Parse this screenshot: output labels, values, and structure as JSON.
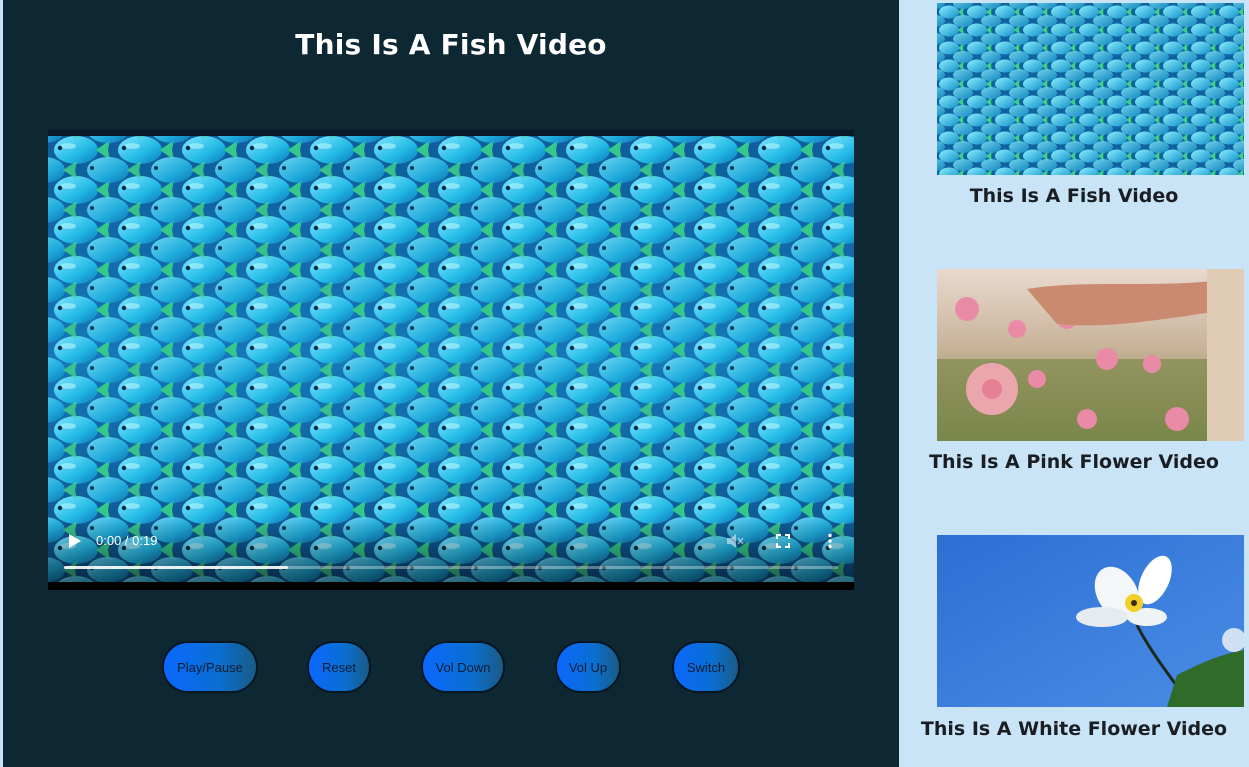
{
  "main": {
    "title": "This Is A Fish Video"
  },
  "player": {
    "current_time": "0:00",
    "duration": "0:19",
    "time_display": "0:00 / 0:19",
    "progress_fraction": 0.29
  },
  "buttons": [
    {
      "label": "Play/Pause"
    },
    {
      "label": "Reset"
    },
    {
      "label": "Vol Down"
    },
    {
      "label": "Vol Up"
    },
    {
      "label": "Switch"
    }
  ],
  "playlist": [
    {
      "title": "This Is A Fish Video"
    },
    {
      "title": "This Is A Pink Flower Video"
    },
    {
      "title": "This Is A White Flower Video"
    }
  ],
  "icons": {
    "play": "play-icon",
    "volume": "volume-muted-icon",
    "fullscreen": "fullscreen-icon",
    "more": "more-vertical-icon"
  },
  "colors": {
    "main_background": "#0e2833",
    "sidebar_background": "#c9e4f7",
    "button_gradient_start": "#0b68ff",
    "button_gradient_end": "#1a5b86"
  }
}
